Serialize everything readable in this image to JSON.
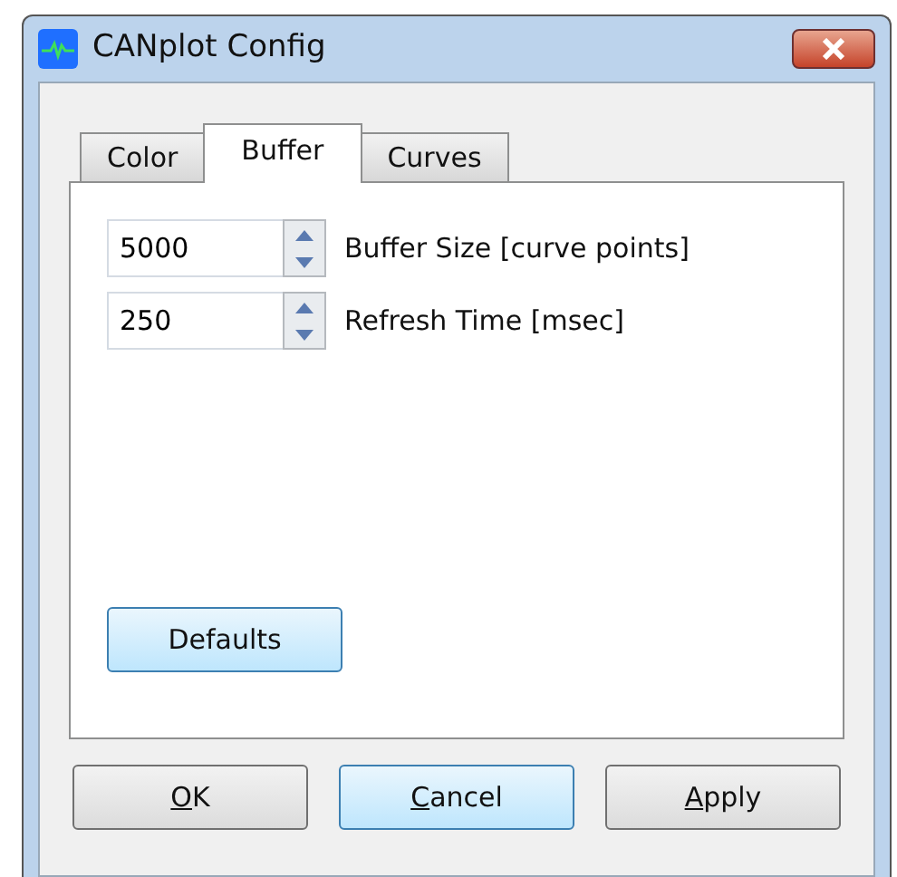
{
  "window": {
    "title": "CANplot Config"
  },
  "tabs": [
    {
      "label": "Color",
      "selected": false
    },
    {
      "label": "Buffer",
      "selected": true
    },
    {
      "label": "Curves",
      "selected": false
    }
  ],
  "fields": [
    {
      "value": "5000",
      "label": "Buffer Size [curve points]"
    },
    {
      "value": "250",
      "label": "Refresh Time [msec]"
    }
  ],
  "defaults_button": {
    "label": "Defaults",
    "highlighted": true
  },
  "buttons": [
    {
      "label": "OK",
      "mnemonic_underlined": true,
      "highlighted": false
    },
    {
      "label": "Cancel",
      "mnemonic_underlined": true,
      "highlighted": true
    },
    {
      "label": "Apply",
      "mnemonic_underlined": true,
      "highlighted": false
    }
  ]
}
